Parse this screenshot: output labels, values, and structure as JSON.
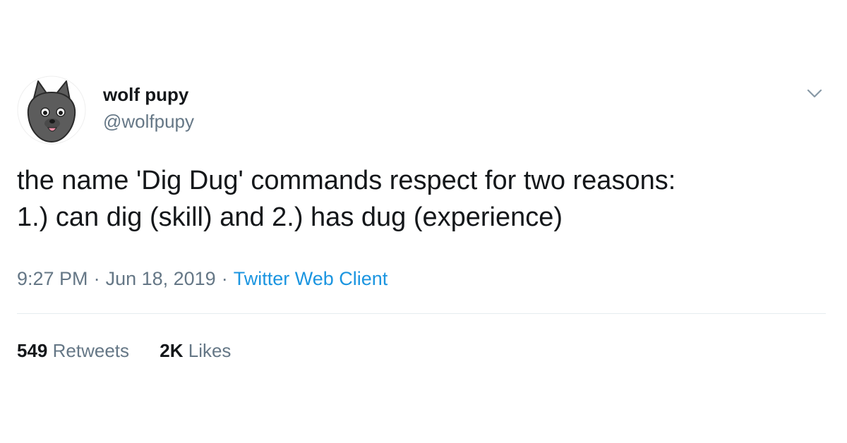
{
  "user": {
    "display_name": "wolf pupy",
    "handle": "@wolfpupy",
    "avatar_icon": "wolf-pup-avatar"
  },
  "tweet": {
    "text_lines": [
      "the name 'Dig Dug' commands respect for two reasons:",
      "1.) can dig (skill) and 2.) has dug (experience)"
    ]
  },
  "meta": {
    "time": "9:27 PM",
    "separator": "·",
    "date": "Jun 18, 2019",
    "source": "Twitter Web Client"
  },
  "stats": {
    "retweets_count": "549",
    "retweets_label": "Retweets",
    "likes_count": "2K",
    "likes_label": "Likes"
  },
  "icons": {
    "menu": "chevron-down-icon"
  },
  "colors": {
    "text_primary": "#14171a",
    "text_secondary": "#657786",
    "link": "#1b95e0",
    "divider": "#e6ecf0",
    "avatar_fur": "#5c5c5c"
  }
}
